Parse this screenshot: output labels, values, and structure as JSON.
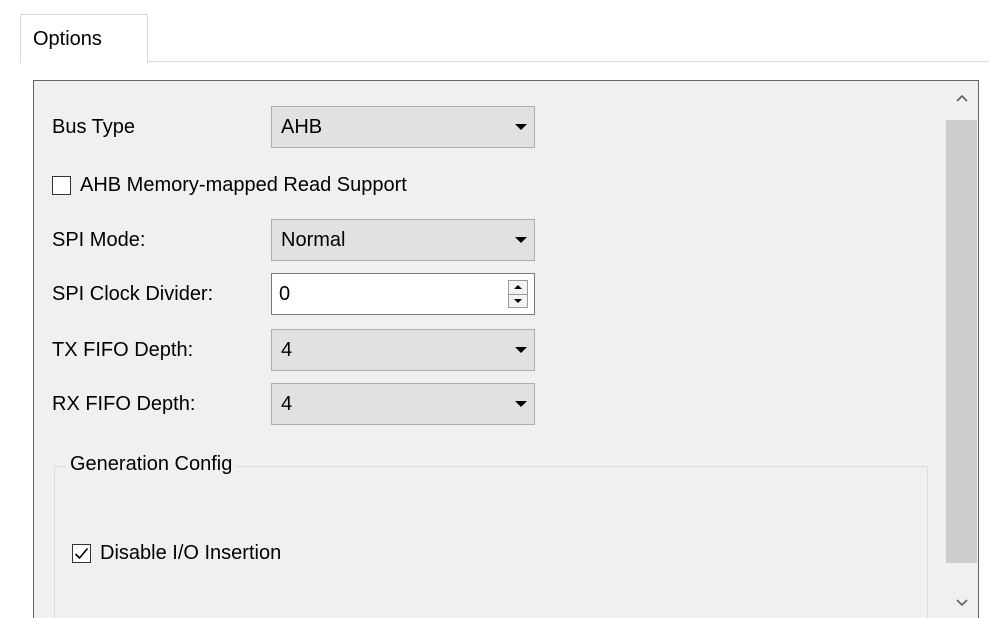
{
  "tabs": [
    {
      "label": "Options",
      "active": true
    }
  ],
  "form": {
    "bus_type": {
      "label": "Bus Type",
      "value": "AHB"
    },
    "ahb_read_support": {
      "label": "AHB Memory-mapped Read Support",
      "checked": false
    },
    "spi_mode": {
      "label": "SPI Mode:",
      "value": "Normal"
    },
    "spi_clock_divider": {
      "label": "SPI Clock Divider:",
      "value": "0"
    },
    "tx_fifo_depth": {
      "label": "TX FIFO Depth:",
      "value": "4"
    },
    "rx_fifo_depth": {
      "label": "RX FIFO Depth:",
      "value": "4"
    }
  },
  "generation_config": {
    "title": "Generation Config",
    "disable_io_insertion": {
      "label": "Disable I/O Insertion",
      "checked": true
    }
  },
  "icons": {
    "dropdown": "chevron-down-icon",
    "spin_up": "spin-up-icon",
    "spin_down": "spin-down-icon",
    "scroll_up": "chevron-up-icon",
    "scroll_down": "chevron-down-icon"
  },
  "colors": {
    "panel_bg": "#f0f0f0",
    "combo_bg": "#e1e1e1",
    "scroll_thumb": "#cdcdcd"
  }
}
